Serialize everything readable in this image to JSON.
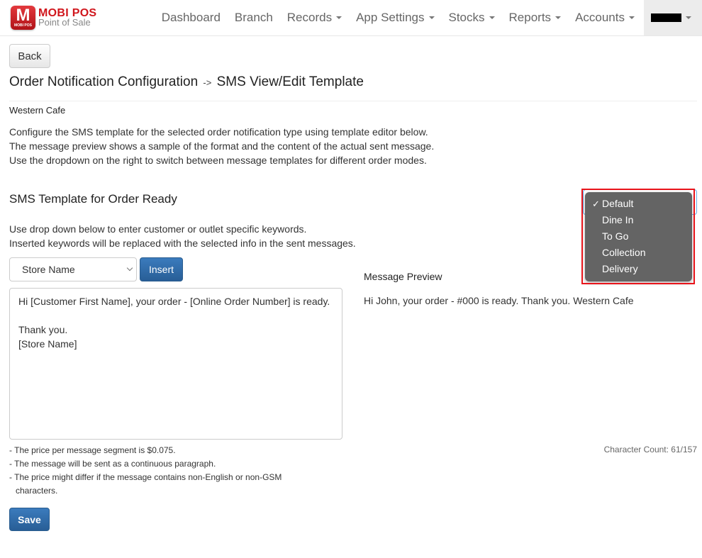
{
  "navbar": {
    "brand": {
      "logo_letter": "M",
      "logo_sub": "MOBI POS",
      "title": "MOBI POS",
      "subtitle": "Point of Sale"
    },
    "items": [
      {
        "label": "Dashboard",
        "dropdown": false
      },
      {
        "label": "Branch",
        "dropdown": false
      },
      {
        "label": "Records",
        "dropdown": true
      },
      {
        "label": "App Settings",
        "dropdown": true
      },
      {
        "label": "Stocks",
        "dropdown": true
      },
      {
        "label": "Reports",
        "dropdown": true
      },
      {
        "label": "Accounts",
        "dropdown": true
      }
    ],
    "user_menu": {
      "label": "[redacted]",
      "dropdown": true
    }
  },
  "page": {
    "back_label": "Back",
    "title_main": "Order Notification Configuration",
    "title_arrow": "->",
    "title_sub": "SMS View/Edit Template",
    "store_name": "Western Cafe",
    "description": [
      "Configure the SMS template for the selected order notification type using template editor below.",
      "The message preview shows a sample of the format and the content of the actual sent message.",
      "Use the dropdown on the right to switch between message templates for different order modes."
    ],
    "section_title": "SMS Template for Order Ready",
    "keyword_help": [
      "Use drop down below to enter customer or outlet specific keywords.",
      "Inserted keywords will be replaced with the selected info in the sent messages."
    ]
  },
  "editor": {
    "keyword_select_value": "Store Name",
    "insert_label": "Insert",
    "template_text": "Hi [Customer First Name], your order - [Online Order Number] is ready.\n\nThank you.\n[Store Name]",
    "notes": [
      "- The price per message segment is $0.075.",
      "- The message will be sent as a continuous paragraph.",
      "- The price might differ if the message contains non-English or non-GSM characters."
    ],
    "save_label": "Save"
  },
  "preview": {
    "title": "Message Preview",
    "text": "Hi John, your order - #000 is ready. Thank you. Western Cafe",
    "char_count_label": "Character Count: 61/157"
  },
  "mode_dropdown": {
    "selected": "Default",
    "check_glyph": "✓",
    "options": [
      "Default",
      "Dine In",
      "To Go",
      "Collection",
      "Delivery"
    ],
    "highlight_color": "#e8141b"
  }
}
